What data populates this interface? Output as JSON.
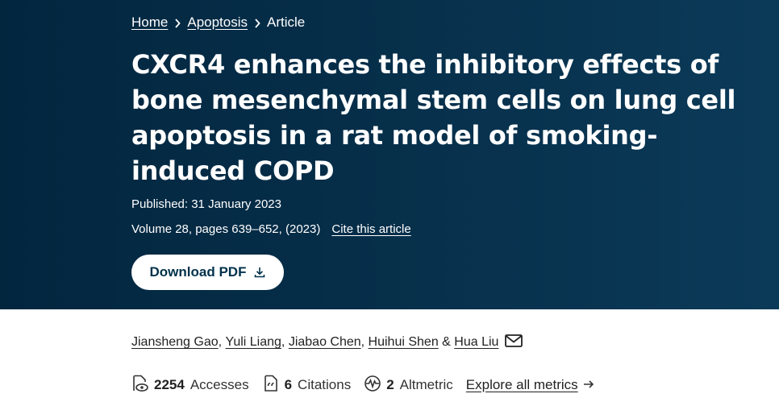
{
  "breadcrumb": {
    "items": [
      "Home",
      "Apoptosis",
      "Article"
    ]
  },
  "article": {
    "title": "CXCR4 enhances the inhibitory effects of bone mesenchymal stem cells on lung cell apoptosis in a rat model of smoking-induced COPD",
    "published": "Published: 31 January 2023",
    "volume": "Volume 28, pages 639–652, (2023)",
    "cite_label": "Cite this article",
    "download_label": "Download PDF"
  },
  "authors": {
    "names": [
      "Jiansheng Gao",
      "Yuli Liang",
      "Jiabao Chen",
      "Huihui Shen",
      "Hua Liu"
    ],
    "separators": [
      ", ",
      ", ",
      ", ",
      " & "
    ]
  },
  "metrics": {
    "accesses_count": "2254",
    "accesses_label": "Accesses",
    "citations_count": "6",
    "citations_label": "Citations",
    "altmetric_count": "2",
    "altmetric_label": "Altmetric",
    "explore_label": "Explore all metrics"
  },
  "icons": {
    "breadcrumb_separator": "chevron-right-icon",
    "download": "download-icon",
    "mail": "mail-icon",
    "accesses": "eye-document-icon",
    "citations": "quote-document-icon",
    "altmetric": "altmetric-icon",
    "explore": "arrow-right-icon"
  },
  "colors": {
    "hero_background": "#03263f",
    "hero_text": "#ffffff",
    "button_text": "#01324b",
    "body_text": "#222222"
  }
}
